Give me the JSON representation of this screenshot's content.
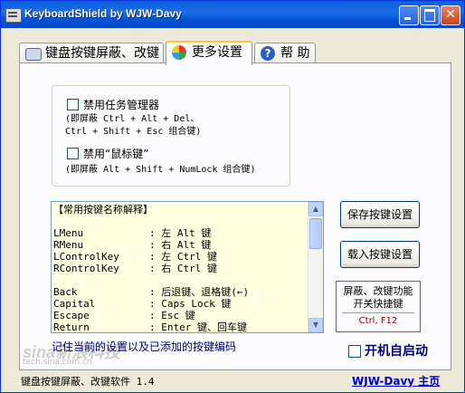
{
  "window": {
    "title": "KeyboardShield by WJW-Davy",
    "min_glyph": "_",
    "close_glyph": "✕"
  },
  "tabs": [
    {
      "label": "键盘按键屏蔽、改键",
      "icon": "keyboard-icon",
      "active": false
    },
    {
      "label": "更多设置",
      "icon": "windows-flag-icon",
      "active": true
    },
    {
      "label": "帮 助",
      "icon": "help-icon",
      "active": false
    }
  ],
  "options": {
    "disable_task_manager": {
      "label": "禁用任务管理器",
      "note": "(即屏蔽 Ctrl + Alt + Del、\nCtrl + Shift + Esc 组合键)",
      "checked": false
    },
    "disable_mouse_keys": {
      "label": "禁用“鼠标键”",
      "note": "(即屏蔽 Alt + Shift + NumLock 组合键)",
      "checked": false
    }
  },
  "key_names": {
    "header": "【常用按键名称解释】",
    "entries": [
      {
        "key": "LMenu",
        "desc": "左 Alt 键"
      },
      {
        "key": "RMenu",
        "desc": "右 Alt 键"
      },
      {
        "key": "LControlKey",
        "desc": "左 Ctrl 键"
      },
      {
        "key": "RControlKey",
        "desc": "右 Ctrl 键"
      },
      {
        "key": "",
        "desc": ""
      },
      {
        "key": "Back",
        "desc": "后退键、退格键(←)"
      },
      {
        "key": "Capital",
        "desc": "Caps Lock 键"
      },
      {
        "key": "Escape",
        "desc": "Esc 键"
      },
      {
        "key": "Return",
        "desc": "Enter 键、回车键"
      }
    ]
  },
  "buttons": {
    "save": "保存按键设置",
    "load": "载入按键设置"
  },
  "hotkey": {
    "title_line1": "屏蔽、改键功能",
    "title_line2": "开关快捷键",
    "value": "Ctrl, F12"
  },
  "remember_label": "记住当前的设置以及已添加的按键编码",
  "autostart": {
    "label": "开机自启动",
    "checked": false
  },
  "status": {
    "app_name": "键盘按键屏蔽、改键软件 1.4",
    "homepage": "WJW-Davy 主页"
  },
  "watermark": {
    "text": "sina新浪科技",
    "url": "tech.sina.com.cn"
  },
  "colors": {
    "titlebar": "#0a5fdc",
    "panel_bg": "#fcfcfe",
    "listbox_bg": "#ffffe1",
    "hotkey_value": "#8b0000",
    "link": "#0000cc"
  }
}
